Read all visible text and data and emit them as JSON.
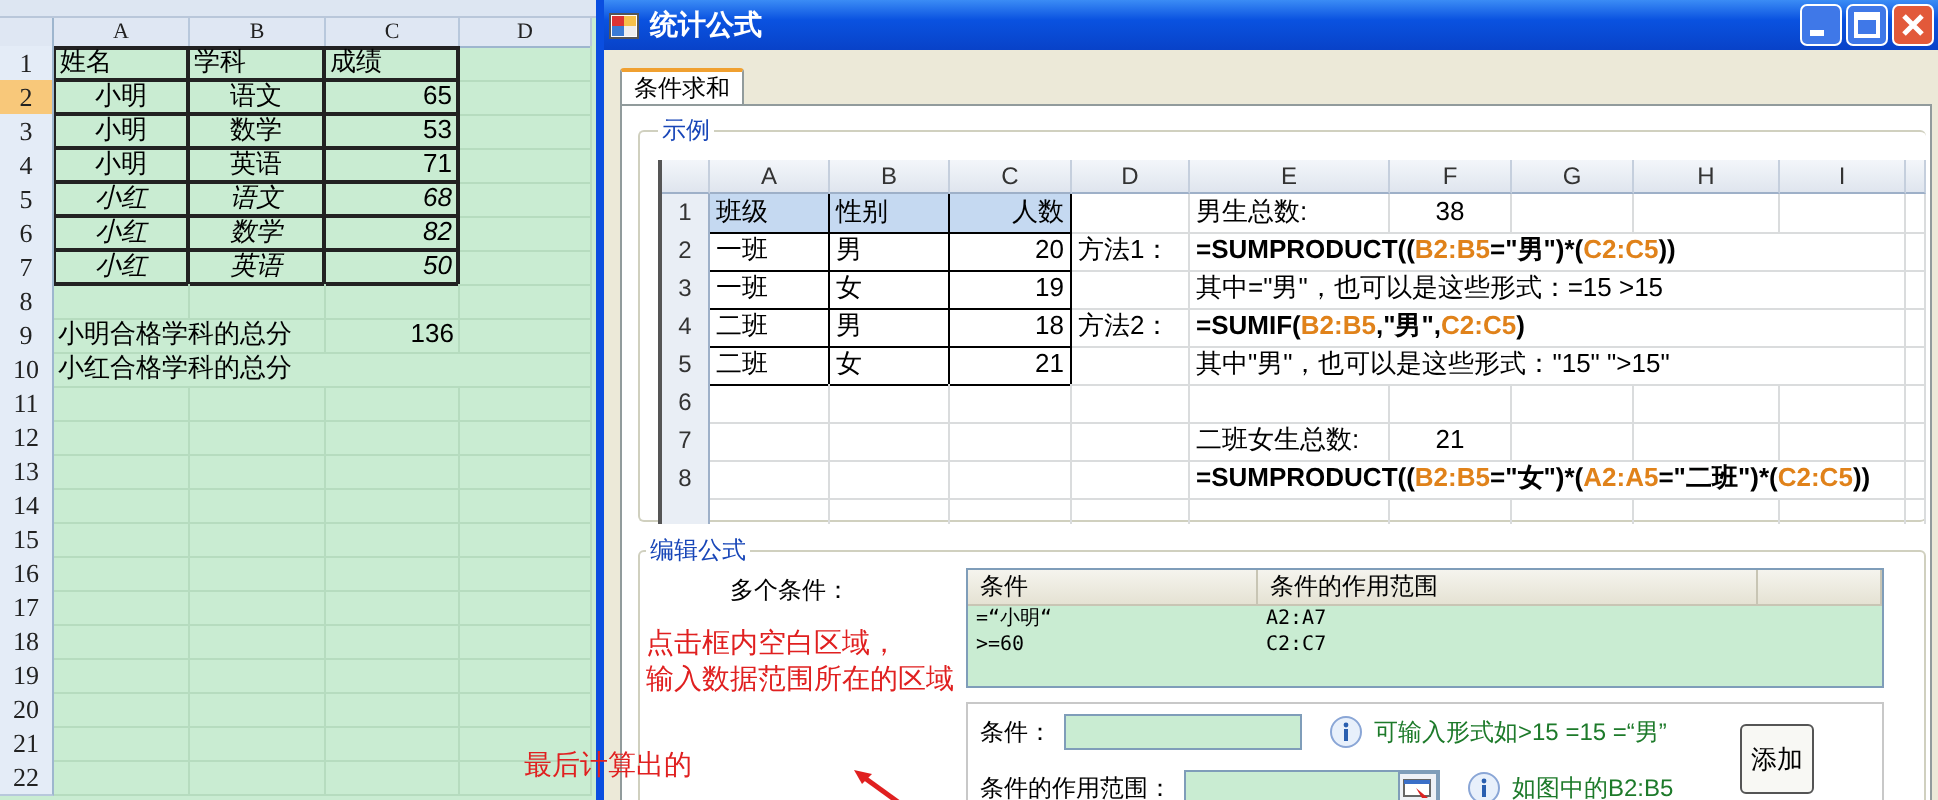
{
  "spreadsheet": {
    "columns": [
      "A",
      "B",
      "C",
      "D"
    ],
    "rows": [
      {
        "number": "1",
        "selected": false,
        "kind": "header",
        "a": "姓名",
        "b": "学科",
        "c": "成绩"
      },
      {
        "number": "2",
        "selected": true,
        "kind": "record",
        "italic": false,
        "a": "小明",
        "b": "语文",
        "c": "65"
      },
      {
        "number": "3",
        "selected": false,
        "kind": "record",
        "italic": false,
        "a": "小明",
        "b": "数学",
        "c": "53"
      },
      {
        "number": "4",
        "selected": false,
        "kind": "record",
        "italic": false,
        "a": "小明",
        "b": "英语",
        "c": "71"
      },
      {
        "number": "5",
        "selected": false,
        "kind": "record",
        "italic": true,
        "a": "小红",
        "b": "语文",
        "c": "68"
      },
      {
        "number": "6",
        "selected": false,
        "kind": "record",
        "italic": true,
        "a": "小红",
        "b": "数学",
        "c": "82"
      },
      {
        "number": "7",
        "selected": false,
        "kind": "record",
        "italic": true,
        "a": "小红",
        "b": "英语",
        "c": "50"
      },
      {
        "number": "8",
        "selected": false,
        "kind": "note"
      },
      {
        "number": "9",
        "selected": false,
        "kind": "note",
        "a": "小明合格学科的总分",
        "c": "136"
      },
      {
        "number": "10",
        "selected": false,
        "kind": "note",
        "a": "小红合格学科的总分"
      },
      {
        "number": "11",
        "selected": false,
        "kind": "note"
      },
      {
        "number": "12",
        "selected": false,
        "kind": "note"
      },
      {
        "number": "13",
        "selected": false,
        "kind": "note"
      },
      {
        "number": "14",
        "selected": false,
        "kind": "note"
      },
      {
        "number": "15",
        "selected": false,
        "kind": "note"
      },
      {
        "number": "16",
        "selected": false,
        "kind": "note"
      },
      {
        "number": "17",
        "selected": false,
        "kind": "note"
      },
      {
        "number": "18",
        "selected": false,
        "kind": "note"
      },
      {
        "number": "19",
        "selected": false,
        "kind": "note"
      },
      {
        "number": "20",
        "selected": false,
        "kind": "note"
      },
      {
        "number": "21",
        "selected": false,
        "kind": "note"
      },
      {
        "number": "22",
        "selected": false,
        "kind": "note"
      }
    ]
  },
  "dialog": {
    "title": "统计公式",
    "tabs": [
      {
        "label": "条件求和",
        "selected": true
      }
    ],
    "example": {
      "legend": "示例",
      "columns": [
        "A",
        "B",
        "C",
        "D",
        "E",
        "F",
        "G",
        "H",
        "I"
      ],
      "rows": [
        {
          "number": "1",
          "kind": "header",
          "a": "班级",
          "b": "性别",
          "c": "人数",
          "e": "男生总数:",
          "f": "38"
        },
        {
          "number": "2",
          "kind": "record",
          "a": "一班",
          "b": "男",
          "c": "20",
          "d": "方法1：",
          "e": [
            {
              "text": "=SUMPRODUCT((",
              "ref": false
            },
            {
              "text": "B2:B5",
              "ref": true
            },
            {
              "text": "=\"男\")*(",
              "ref": false
            },
            {
              "text": "C2:C5",
              "ref": true
            },
            {
              "text": "))",
              "ref": false
            }
          ]
        },
        {
          "number": "3",
          "kind": "record",
          "a": "一班",
          "b": "女",
          "c": "19",
          "e": "其中=\"男\"，也可以是这些形式：=15   >15"
        },
        {
          "number": "4",
          "kind": "record",
          "a": "二班",
          "b": "男",
          "c": "18",
          "d": "方法2：",
          "e": [
            {
              "text": "=SUMIF(",
              "ref": false
            },
            {
              "text": "B2:B5",
              "ref": true
            },
            {
              "text": ",\"男\",",
              "ref": false
            },
            {
              "text": "C2:C5",
              "ref": true
            },
            {
              "text": ")",
              "ref": false
            }
          ]
        },
        {
          "number": "5",
          "kind": "record",
          "a": "二班",
          "b": "女",
          "c": "21",
          "e": "其中\"男\"，也可以是这些形式：\"15\"  \">15\""
        },
        {
          "number": "6",
          "kind": "plain"
        },
        {
          "number": "7",
          "kind": "plain",
          "e": " 二班女生总数:",
          "f": "21"
        },
        {
          "number": "8",
          "kind": "plain",
          "e": [
            {
              "text": "=SUMPRODUCT((",
              "ref": false
            },
            {
              "text": "B2:B5",
              "ref": true
            },
            {
              "text": "=\"女\")*(",
              "ref": false
            },
            {
              "text": "A2:A5",
              "ref": true
            },
            {
              "text": "=\"二班\")*(",
              "ref": false
            },
            {
              "text": "C2:C5",
              "ref": true
            },
            {
              "text": "))",
              "ref": false
            }
          ]
        }
      ]
    },
    "editor": {
      "legend": "编辑公式",
      "conditions_label": "多个条件：",
      "list": {
        "columns": [
          "条件",
          "条件的作用范围"
        ],
        "rows": [
          {
            "condition": "=“小明“",
            "range": "A2:A7"
          },
          {
            "condition": ">=60",
            "range": "C2:C7"
          }
        ]
      },
      "annotation_lines": [
        "点击框内空白区域，",
        "输入数据范围所在的区域"
      ],
      "condition_field": {
        "label": "条件：",
        "hint": "可输入形式如>15  =15  =“男”"
      },
      "range_field": {
        "label": "条件的作用范围：",
        "hint": "如图中的B2:B5"
      },
      "add_button": "添加"
    },
    "result_note": "最后计算出的"
  }
}
